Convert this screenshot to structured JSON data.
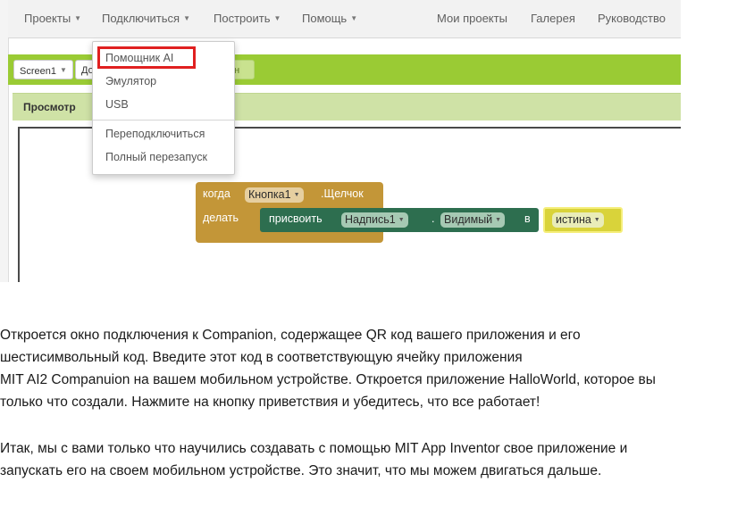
{
  "nav": {
    "projects": "Проекты",
    "connect": "Подключиться",
    "build": "Построить",
    "help": "Помощь",
    "my_projects": "Мои проекты",
    "gallery": "Галерея",
    "guide": "Руководство"
  },
  "toolbar": {
    "screen": "Screen1",
    "add_screen_partial": "До",
    "remove_partial": "ан"
  },
  "viewer": {
    "label": "Просмотр"
  },
  "connect_menu": {
    "items": [
      "Помощник AI",
      "Эмулятор",
      "USB"
    ],
    "items2": [
      "Переподключиться",
      "Полный перезапуск"
    ]
  },
  "blocks": {
    "when": "когда",
    "component": "Кнопка1",
    "event": ".Щелчок",
    "do": "делать",
    "set": "присвоить",
    "target": "Надпись1",
    "dot": ".",
    "property": "Видимый",
    "to": "в",
    "value": "истина"
  },
  "text": {
    "p1_l1": "Откроется окно подключения к Companion, содержащее QR код вашего приложения и его",
    "p1_l2": "шестисимвольный код. Введите этот код в соответствующую ячейку приложения",
    "p1_l3": "MIT AI2 Companuion на вашем мобильном устройстве. Откроется приложение HalloWorld, которое вы",
    "p1_l4": "только что создали. Нажмите на кнопку приветствия и убедитесь, что все работает!",
    "p2_l1": "Итак, мы с вами только что научились создавать с помощью MIT App Inventor свое приложение и",
    "p2_l2": "запускать его на своем мобильном устройстве. Это значит, что мы можем двигаться дальше."
  },
  "colors": {
    "toolbar_green": "#9acb34",
    "event_block": "#c39638",
    "set_block": "#2d6e4f",
    "logic_block": "#d9d33a",
    "highlight": "#e02020"
  }
}
